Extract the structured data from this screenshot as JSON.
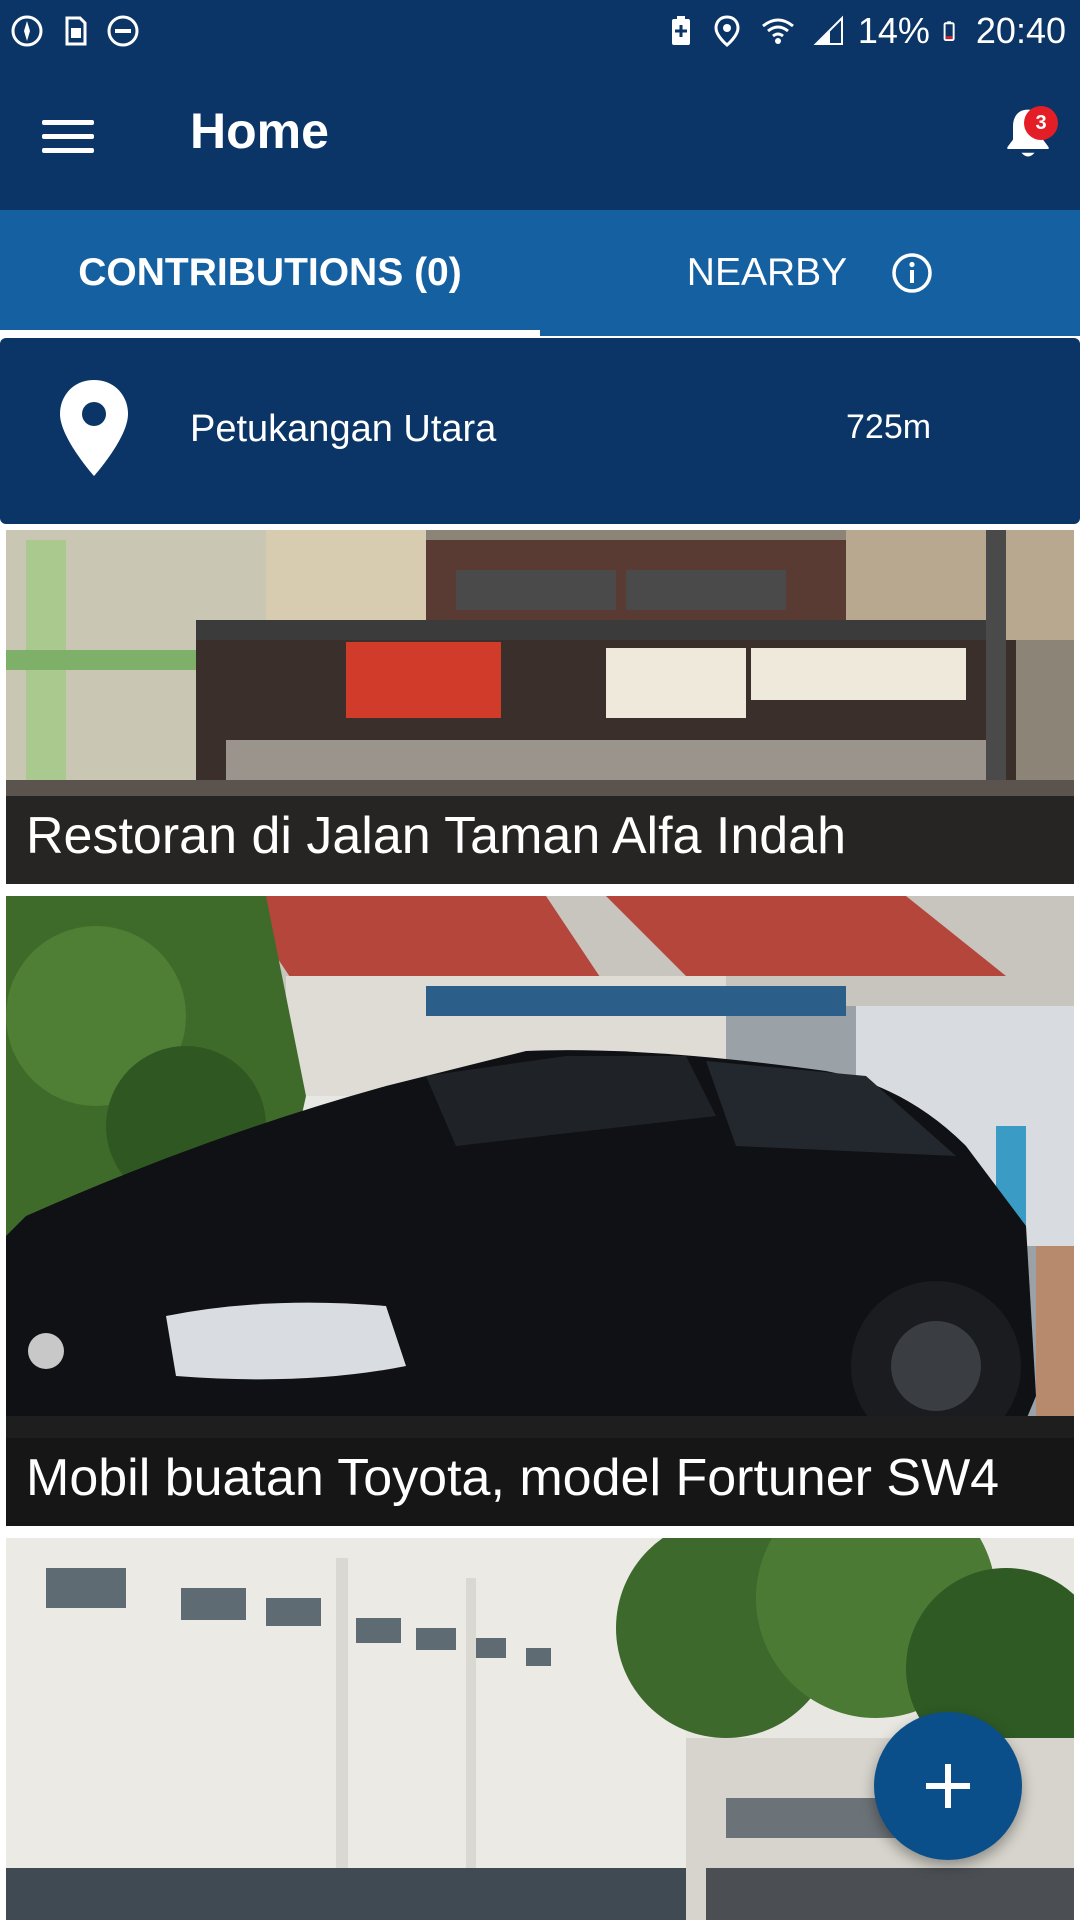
{
  "status_bar": {
    "battery": "14%",
    "time": "20:40"
  },
  "app_bar": {
    "title": "Home",
    "notification_count": "3"
  },
  "tabs": [
    {
      "label": "CONTRIBUTIONS (0)",
      "selected": true
    },
    {
      "label": "NEARBY",
      "selected": false
    }
  ],
  "nearby": {
    "place": "Petukangan Utara",
    "distance": "725m"
  },
  "feed": [
    {
      "caption": "Restoran di Jalan Taman Alfa Indah"
    },
    {
      "caption": "Mobil buatan Toyota, model Fortuner SW4"
    },
    {
      "caption": ""
    }
  ],
  "colors": {
    "primary_dark": "#0b3566",
    "tab_bar": "#1560a0",
    "badge": "#e41e26",
    "fab": "#0b4f8a"
  },
  "icons": {
    "menu": "hamburger-menu-icon",
    "bell": "bell-icon",
    "info": "info-icon",
    "pin": "map-pin-icon",
    "fab": "plus-icon"
  }
}
